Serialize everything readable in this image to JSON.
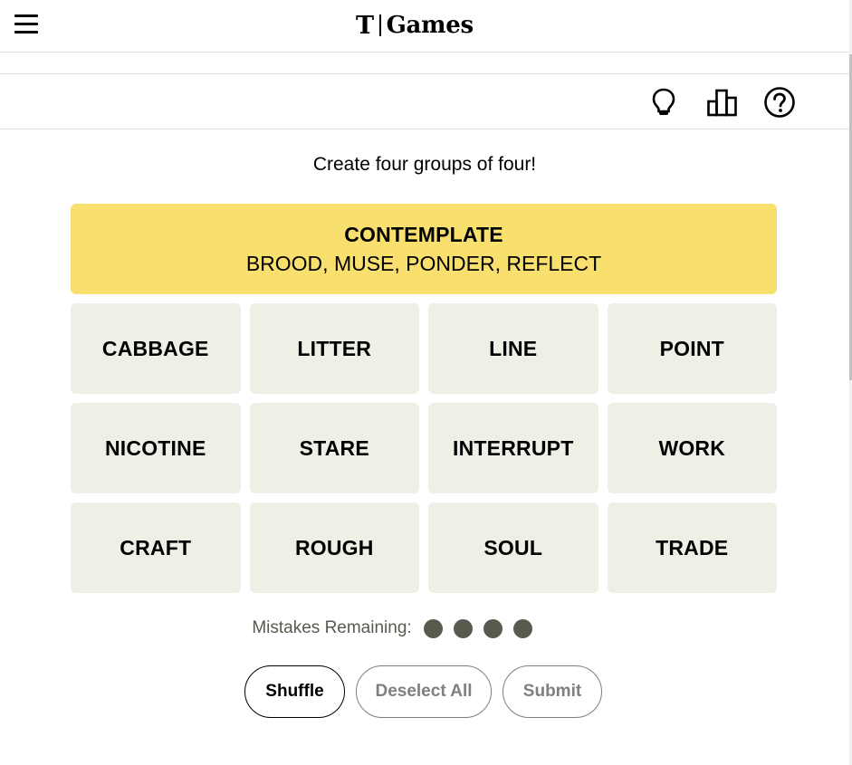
{
  "header": {
    "logo_mark": "T",
    "logo_text": "Games"
  },
  "toolbar": {
    "icons": [
      "lightbulb-icon",
      "leaderboard-icon",
      "help-icon"
    ]
  },
  "game": {
    "instructions": "Create four groups of four!",
    "solved_groups": [
      {
        "title": "CONTEMPLATE",
        "members": "BROOD, MUSE, PONDER, REFLECT",
        "color": "#f9df6d"
      }
    ],
    "tiles": [
      "CABBAGE",
      "LITTER",
      "LINE",
      "POINT",
      "NICOTINE",
      "STARE",
      "INTERRUPT",
      "WORK",
      "CRAFT",
      "ROUGH",
      "SOUL",
      "TRADE"
    ],
    "mistakes_label": "Mistakes Remaining:",
    "mistakes_remaining": 4,
    "buttons": {
      "shuffle": "Shuffle",
      "deselect": "Deselect All",
      "submit": "Submit"
    }
  },
  "colors": {
    "tile_bg": "#efefe6",
    "yellow_group": "#f9df6d",
    "dot": "#5a594e",
    "disabled_text": "#7f7f7f"
  }
}
